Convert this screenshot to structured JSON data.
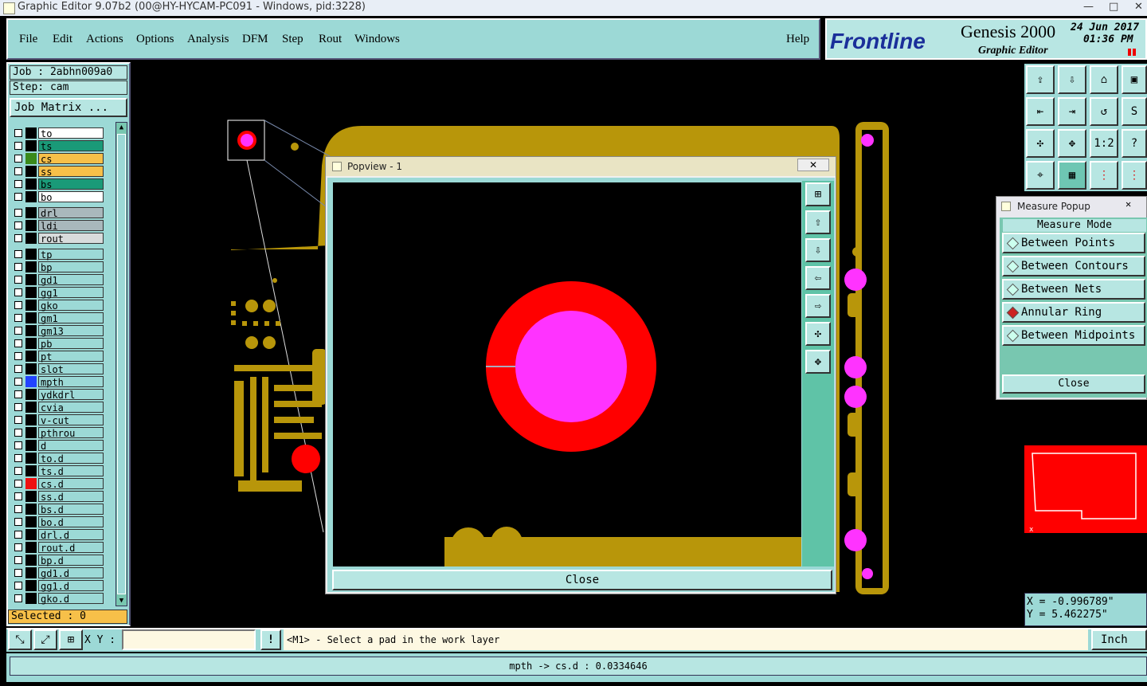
{
  "window": {
    "title": "Graphic Editor 9.07b2 (00@HY-HYCAM-PC091 - Windows, pid:3228)"
  },
  "menu": {
    "items": [
      "File",
      "Edit",
      "Actions",
      "Options",
      "Analysis",
      "DFM",
      "Step",
      "Rout",
      "Windows"
    ],
    "help": "Help"
  },
  "brand": {
    "logo": "Frontline",
    "product": "Genesis 2000",
    "subtitle": "Graphic Editor",
    "date": "24 Jun 2017",
    "time": "01:36 PM"
  },
  "job": {
    "job_label": "Job : 2abhn009a0",
    "step_label": "Step: cam",
    "matrix_button": "Job Matrix ..."
  },
  "layers": [
    {
      "name": "to",
      "bg": "#ffffff",
      "sw": "#000000"
    },
    {
      "name": "ts",
      "bg": "#1a9a78",
      "sw": "#000000"
    },
    {
      "name": "cs",
      "bg": "#f7c049",
      "sw": "#3a8a1a"
    },
    {
      "name": "ss",
      "bg": "#f7c049",
      "sw": "#000000"
    },
    {
      "name": "bs",
      "bg": "#1a9a78",
      "sw": "#000000"
    },
    {
      "name": "bo",
      "bg": "#ffffff",
      "sw": "#000000"
    },
    {
      "name": "drl",
      "bg": "#a9b8bc",
      "sw": "#000000"
    },
    {
      "name": "ldi",
      "bg": "#a9b8bc",
      "sw": "#000000"
    },
    {
      "name": "rout",
      "bg": "#d8dcdc",
      "sw": "#000000"
    },
    {
      "name": "tp",
      "bg": "#9cd9d6",
      "sw": "#000000"
    },
    {
      "name": "bp",
      "bg": "#9cd9d6",
      "sw": "#000000"
    },
    {
      "name": "gd1",
      "bg": "#9cd9d6",
      "sw": "#000000"
    },
    {
      "name": "gg1",
      "bg": "#9cd9d6",
      "sw": "#000000"
    },
    {
      "name": "gko",
      "bg": "#9cd9d6",
      "sw": "#000000"
    },
    {
      "name": "gm1",
      "bg": "#9cd9d6",
      "sw": "#000000"
    },
    {
      "name": "gm13",
      "bg": "#9cd9d6",
      "sw": "#000000"
    },
    {
      "name": "pb",
      "bg": "#9cd9d6",
      "sw": "#000000"
    },
    {
      "name": "pt",
      "bg": "#9cd9d6",
      "sw": "#000000"
    },
    {
      "name": "slot",
      "bg": "#9cd9d6",
      "sw": "#000000"
    },
    {
      "name": "mpth",
      "bg": "#9cd9d6",
      "sw": "#2244ff"
    },
    {
      "name": "ydkdrl",
      "bg": "#9cd9d6",
      "sw": "#000000"
    },
    {
      "name": "cvia",
      "bg": "#9cd9d6",
      "sw": "#000000"
    },
    {
      "name": "v-cut",
      "bg": "#9cd9d6",
      "sw": "#000000"
    },
    {
      "name": "pthrou",
      "bg": "#9cd9d6",
      "sw": "#000000"
    },
    {
      "name": "d",
      "bg": "#9cd9d6",
      "sw": "#000000"
    },
    {
      "name": "to.d",
      "bg": "#9cd9d6",
      "sw": "#000000"
    },
    {
      "name": "ts.d",
      "bg": "#9cd9d6",
      "sw": "#000000"
    },
    {
      "name": "cs.d",
      "bg": "#9cd9d6",
      "sw": "#ee1111"
    },
    {
      "name": "ss.d",
      "bg": "#9cd9d6",
      "sw": "#000000"
    },
    {
      "name": "bs.d",
      "bg": "#9cd9d6",
      "sw": "#000000"
    },
    {
      "name": "bo.d",
      "bg": "#9cd9d6",
      "sw": "#000000"
    },
    {
      "name": "drl.d",
      "bg": "#9cd9d6",
      "sw": "#000000"
    },
    {
      "name": "rout.d",
      "bg": "#9cd9d6",
      "sw": "#000000"
    },
    {
      "name": "bp.d",
      "bg": "#9cd9d6",
      "sw": "#000000"
    },
    {
      "name": "gd1.d",
      "bg": "#9cd9d6",
      "sw": "#000000"
    },
    {
      "name": "gg1.d",
      "bg": "#9cd9d6",
      "sw": "#000000"
    },
    {
      "name": "gko.d",
      "bg": "#9cd9d6",
      "sw": "#000000"
    }
  ],
  "selected": "Selected : 0",
  "popview": {
    "title": "Popview - 1",
    "close": "Close"
  },
  "measure": {
    "title": "Measure Popup",
    "header": "Measure Mode",
    "modes": [
      {
        "label": "Between Points",
        "selected": false
      },
      {
        "label": "Between Contours",
        "selected": false
      },
      {
        "label": "Between Nets",
        "selected": false
      },
      {
        "label": "Annular Ring",
        "selected": true
      },
      {
        "label": "Between Midpoints",
        "selected": false
      }
    ],
    "close": "Close"
  },
  "toolbar_right": [
    "1:2",
    "?"
  ],
  "coords": {
    "x": "X = -0.996789\"",
    "y": "Y = 5.462275\""
  },
  "bottom": {
    "xy_label": "X Y :",
    "xy_value": "",
    "prompt": "<M1> - Select a pad in the work layer",
    "units": "Inch",
    "status": "mpth -> cs.d : 0.0334646"
  },
  "colors": {
    "panel": "#9cd9d6",
    "copper": "#b8960a",
    "pad": "#ff0000",
    "drill": "#ff33ff"
  }
}
